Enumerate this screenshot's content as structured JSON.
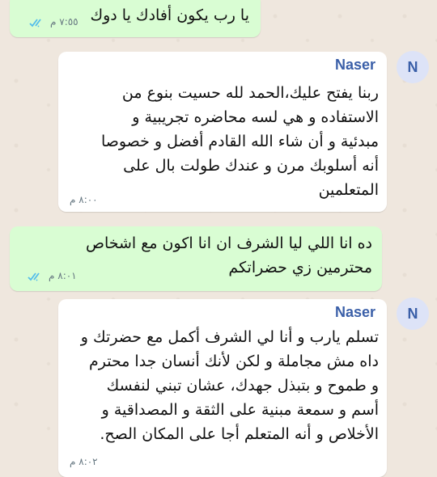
{
  "messages": [
    {
      "text": "يا رب يكون أفادك يا دوك",
      "time": "٧:٥٥ م"
    },
    {
      "sender": "Naser",
      "avatar_letter": "N",
      "lines": [
        "ربنا يفتح عليك،الحمد لله حسيت بنوع من",
        "الاستفاده و هي لسه محاضره تجريبية و",
        "مبدئية و أن شاء الله القادم أفضل و خصوصا",
        "أنه أسلوبك مرن و عندك طولت بال على",
        "المتعلمين"
      ],
      "time": "٨:٠٠ م"
    },
    {
      "lines": [
        "ده انا اللي ليا الشرف ان انا اكون مع اشخاص",
        "محترمين زي حضراتكم"
      ],
      "time": "٨:٠١ م"
    },
    {
      "sender": "Naser",
      "avatar_letter": "N",
      "lines": [
        "تسلم يارب و أنا لي الشرف أكمل مع حضرتك و",
        "داه مش مجاملة و لكن لأنك أنسان جدا محترم",
        "و طموح و بتبذل جهدك، عشان تبني لنفسك",
        "أسم و سمعة مبنية على الثقة و المصداقية و",
        "الأخلاص و أنه المتعلم أجا على المكان الصح."
      ],
      "time": "٨:٠٢ م"
    }
  ],
  "colors": {
    "outgoing": "#d9fdd3",
    "incoming": "#ffffff",
    "read_ticks": "#53bdeb",
    "sender_name": "#3a5fa8"
  }
}
